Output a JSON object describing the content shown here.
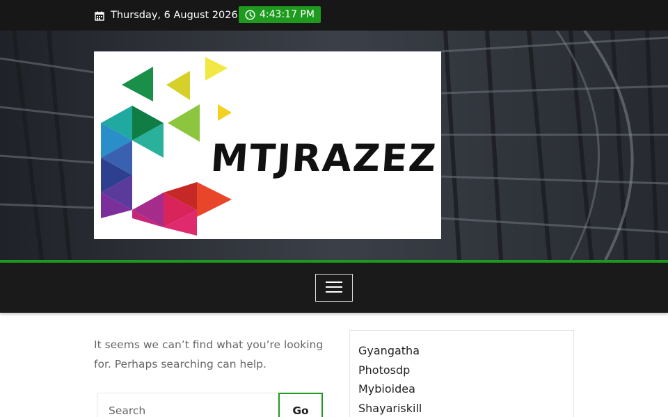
{
  "topbar": {
    "date": "Thursday, 6 August 2026",
    "time": "4:43:17 PM",
    "date_icon": "calendar-icon",
    "time_icon": "clock-icon"
  },
  "header": {
    "logo_text": "MTJRAZEZ"
  },
  "nav": {
    "menu_icon": "hamburger-icon"
  },
  "content": {
    "message": "It seems we can’t find what you’re looking for. Perhaps searching can help.",
    "search_placeholder": "Search",
    "search_button": "Go"
  },
  "sidebar": {
    "links": [
      {
        "label": "Gyangatha"
      },
      {
        "label": "Photosdp"
      },
      {
        "label": "Mybioidea"
      },
      {
        "label": "Shayariskill"
      }
    ]
  },
  "colors": {
    "accent": "#1e9b1e",
    "topbar_bg": "#171717",
    "nav_bg": "#1a1a1a"
  }
}
